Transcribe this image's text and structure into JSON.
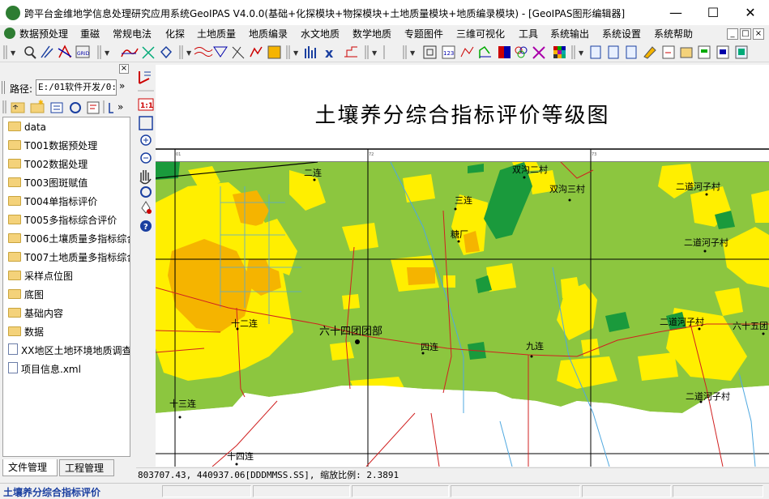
{
  "window": {
    "title": "跨平台金维地学信息处理研究应用系统GeoIPAS V4.0.0(基础+化探模块+物探模块+土地质量模块+地质编录模块) - [GeoIPAS图形编辑器]",
    "minimize": "—",
    "maximize": "☐",
    "close": "✕"
  },
  "menu": {
    "items": [
      "数据预处理",
      "重磁",
      "常规电法",
      "化探",
      "土地质量",
      "地质编录",
      "水文地质",
      "数学地质",
      "专题图件",
      "三维可视化",
      "工具",
      "系统输出",
      "系统设置",
      "系统帮助"
    ],
    "mdi": [
      "_",
      "□",
      "×"
    ]
  },
  "left_panel": {
    "close": "×",
    "path_label": "路径:",
    "path_value": "E:/01软件开发/0:",
    "path_go": "»",
    "files": [
      {
        "name": "data",
        "type": "folder"
      },
      {
        "name": "T001数据预处理",
        "type": "folder"
      },
      {
        "name": "T002数据处理",
        "type": "folder"
      },
      {
        "name": "T003图斑赋值",
        "type": "folder"
      },
      {
        "name": "T004单指标评价",
        "type": "folder"
      },
      {
        "name": "T005多指标综合评价",
        "type": "folder"
      },
      {
        "name": "T006土壤质量多指标综合",
        "type": "folder"
      },
      {
        "name": "T007土地质量多指标综合",
        "type": "folder"
      },
      {
        "name": "采样点位图",
        "type": "folder"
      },
      {
        "name": "底图",
        "type": "folder"
      },
      {
        "name": "基础内容",
        "type": "folder"
      },
      {
        "name": "数据",
        "type": "folder"
      },
      {
        "name": "XX地区土地环境地质调查",
        "type": "file"
      },
      {
        "name": "项目信息.xml",
        "type": "file"
      }
    ],
    "tabs": [
      "文件管理",
      "工程管理"
    ]
  },
  "map": {
    "title": "土壤养分综合指标评价等级图",
    "places": [
      "二连",
      "双沟二村",
      "双沟三村",
      "二道河子村",
      "三连",
      "糖厂",
      "二道河子村",
      "十二连",
      "六十四团团部",
      "四连",
      "九连",
      "二道河子村",
      "六十五团",
      "十三连",
      "二道河子村",
      "十四连"
    ],
    "colors": {
      "green": "#8cc63f",
      "yellow": "#ffef00",
      "orange": "#f5b400",
      "dark_green": "#1a9a3c",
      "white": "#ffffff"
    }
  },
  "status": {
    "coords": "803707.43, 440937.06[DDDMMSS.SS], 缩放比例: 2.3891"
  },
  "bottom": {
    "title": "土壤养分综合指标评价"
  }
}
